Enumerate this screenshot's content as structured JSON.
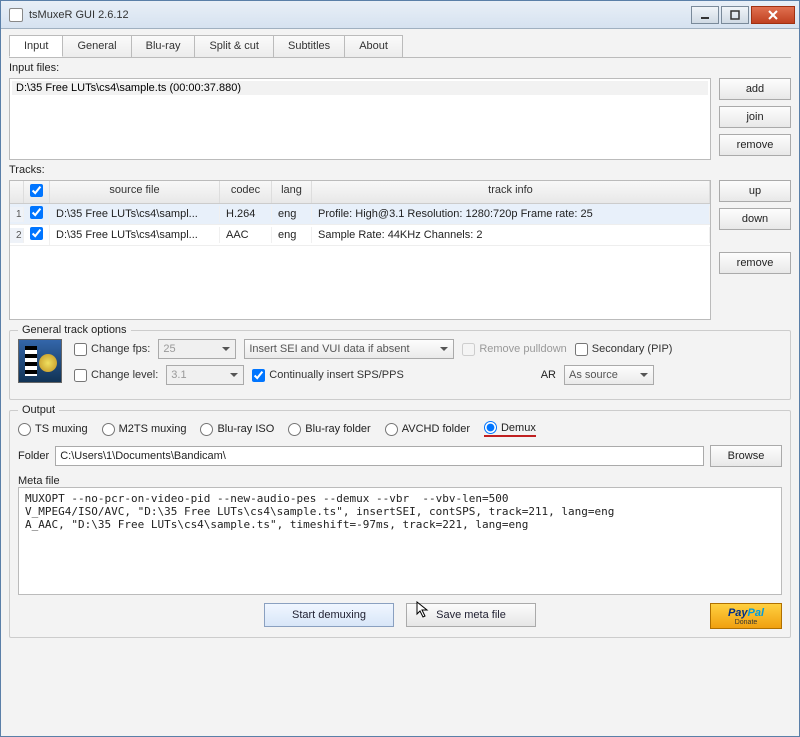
{
  "window": {
    "title": "tsMuxeR GUI 2.6.12"
  },
  "tabs": [
    {
      "label": "Input",
      "active": true
    },
    {
      "label": "General"
    },
    {
      "label": "Blu-ray"
    },
    {
      "label": "Split & cut"
    },
    {
      "label": "Subtitles"
    },
    {
      "label": "About"
    }
  ],
  "labels": {
    "input_files": "Input files:",
    "tracks": "Tracks:",
    "general_track_options": "General track options",
    "output": "Output",
    "folder": "Folder",
    "meta_file": "Meta file"
  },
  "input_files": {
    "items": [
      "D:\\35 Free LUTs\\cs4\\sample.ts (00:00:37.880)"
    ]
  },
  "buttons": {
    "add": "add",
    "join": "join",
    "remove": "remove",
    "up": "up",
    "down": "down",
    "browse": "Browse",
    "start": "Start demuxing",
    "save_meta": "Save meta file"
  },
  "track_headers": {
    "source_file": "source file",
    "codec": "codec",
    "lang": "lang",
    "track_info": "track info"
  },
  "tracks": [
    {
      "num": "1",
      "checked": true,
      "source_file": "D:\\35 Free LUTs\\cs4\\sampl...",
      "codec": "H.264",
      "lang": "eng",
      "info": "Profile: High@3.1  Resolution: 1280:720p  Frame rate: 25"
    },
    {
      "num": "2",
      "checked": true,
      "source_file": "D:\\35 Free LUTs\\cs4\\sampl...",
      "codec": "AAC",
      "lang": "eng",
      "info": "Sample Rate: 44KHz  Channels: 2"
    }
  ],
  "options": {
    "change_fps_label": "Change fps:",
    "change_fps_value": "25",
    "sei_combo": "Insert SEI and VUI data if absent",
    "remove_pulldown": "Remove pulldown",
    "secondary_pip": "Secondary (PIP)",
    "change_level_label": "Change level:",
    "change_level_value": "3.1",
    "cont_sps": "Continually insert SPS/PPS",
    "ar_label": "AR",
    "ar_value": "As source"
  },
  "output_modes": [
    {
      "label": "TS muxing"
    },
    {
      "label": "M2TS muxing"
    },
    {
      "label": "Blu-ray ISO"
    },
    {
      "label": "Blu-ray folder"
    },
    {
      "label": "AVCHD folder"
    },
    {
      "label": "Demux",
      "checked": true,
      "underline": true
    }
  ],
  "folder_path": "C:\\Users\\1\\Documents\\Bandicam\\",
  "meta_text": "MUXOPT --no-pcr-on-video-pid --new-audio-pes --demux --vbr  --vbv-len=500\nV_MPEG4/ISO/AVC, \"D:\\35 Free LUTs\\cs4\\sample.ts\", insertSEI, contSPS, track=211, lang=eng\nA_AAC, \"D:\\35 Free LUTs\\cs4\\sample.ts\", timeshift=-97ms, track=221, lang=eng",
  "paypal": {
    "pay": "Pay",
    "pal": "Pal",
    "donate": "Donate"
  }
}
